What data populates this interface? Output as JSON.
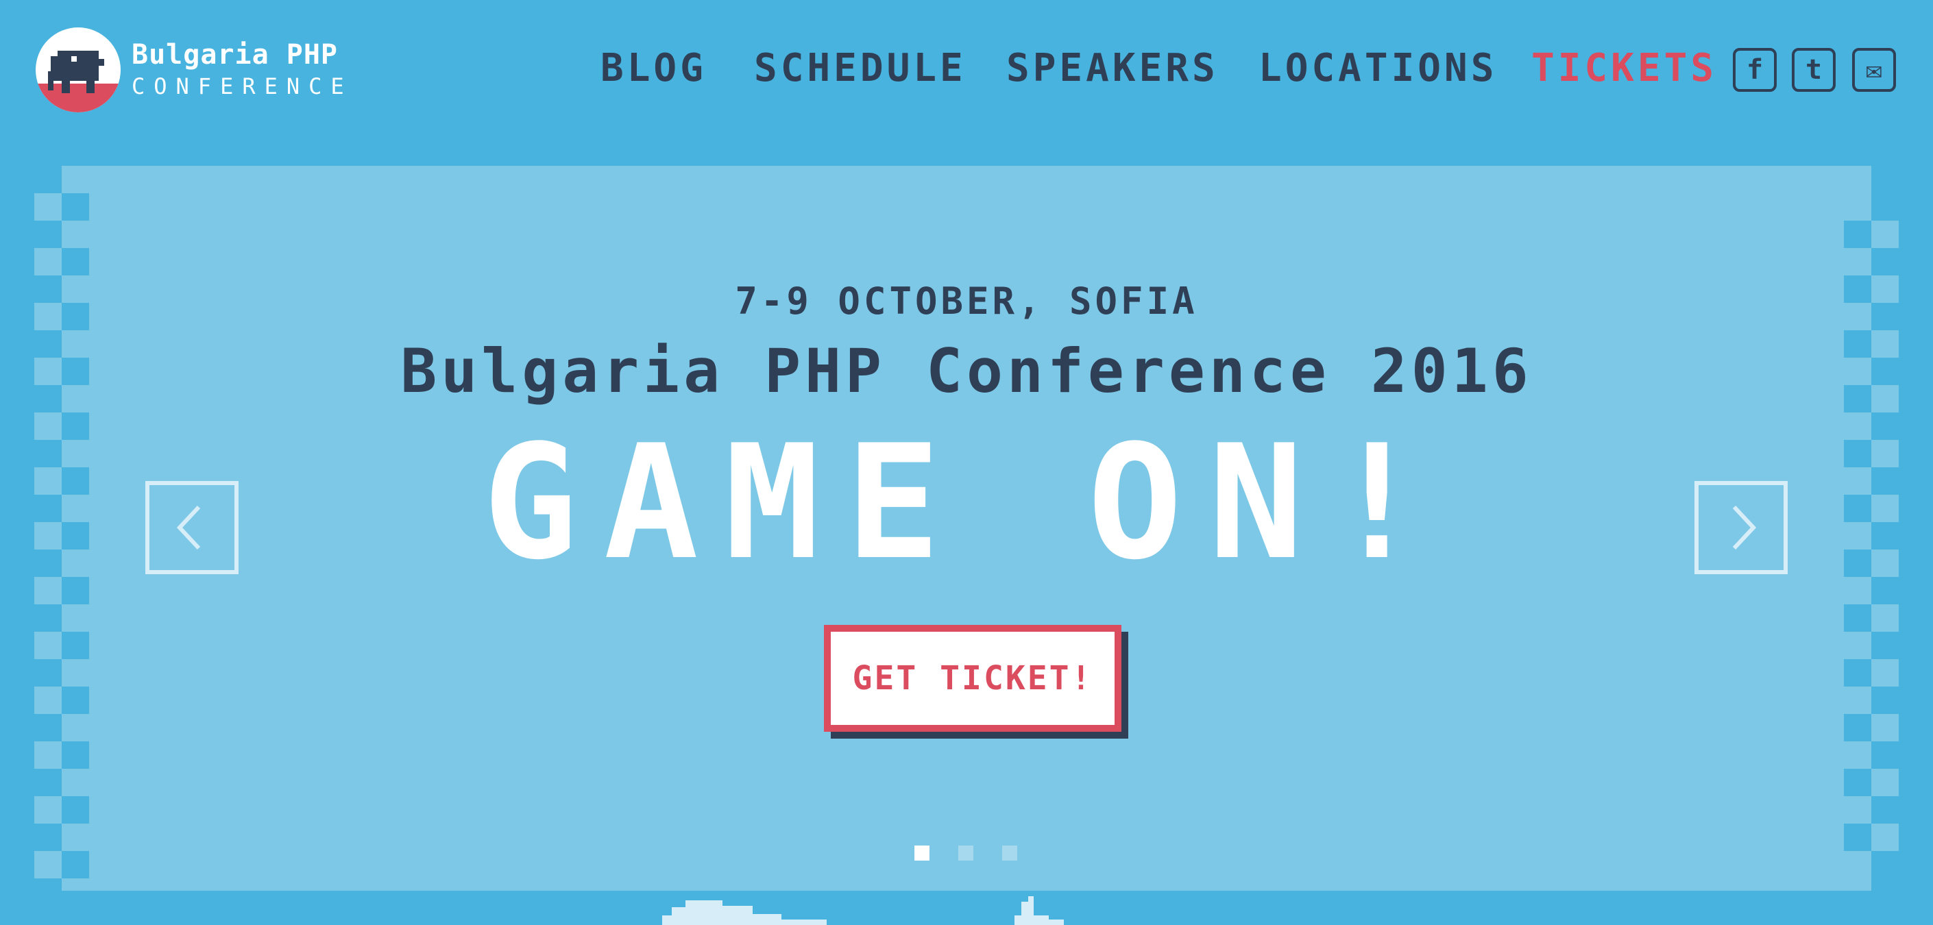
{
  "brand": {
    "title": "Bulgaria PHP",
    "subtitle": "CONFERENCE"
  },
  "nav": {
    "items": [
      "BLOG",
      "SCHEDULE",
      "SPEAKERS",
      "LOCATIONS",
      "TICKETS"
    ]
  },
  "social": {
    "facebook": "f",
    "twitter": "t",
    "email": "✉"
  },
  "hero": {
    "date": "7-9 OCTOBER, SOFIA",
    "title": "Bulgaria PHP Conference 2016",
    "tagline": "GAME ON!",
    "cta": "GET TICKET!"
  },
  "carousel": {
    "slides": 3,
    "active": 1
  },
  "colors": {
    "sky": "#47b3de",
    "panel": "#7ec8e7",
    "navy": "#2f3f56",
    "accent": "#db4c5f",
    "white": "#ffffff"
  }
}
